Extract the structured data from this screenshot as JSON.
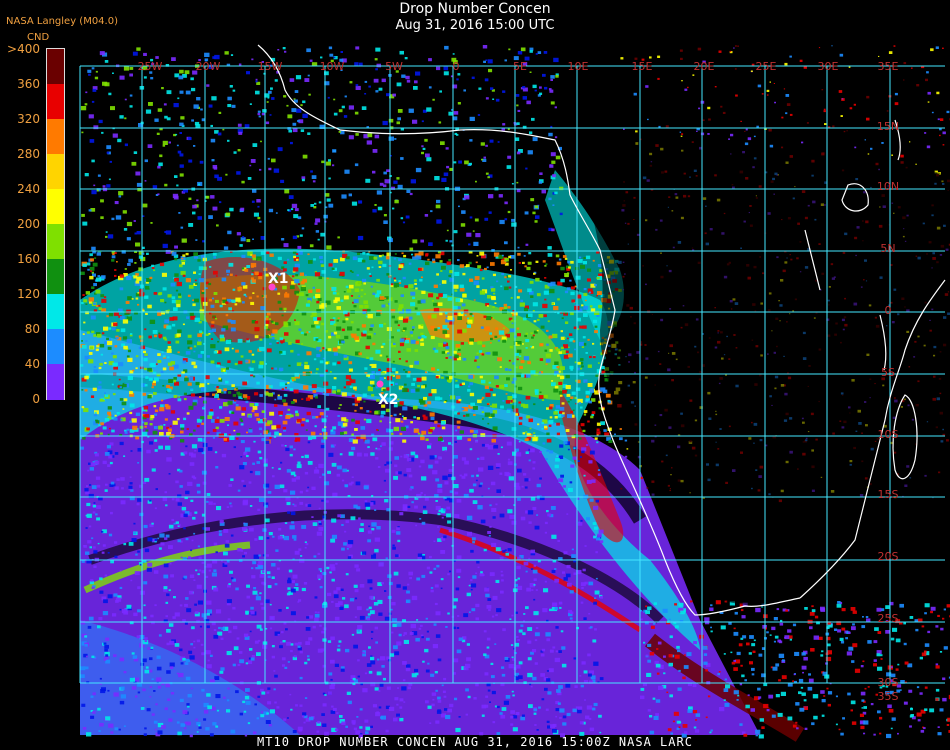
{
  "header": {
    "title": "Drop Number Concen",
    "subtitle": "Aug 31, 2016 15:00 UTC",
    "producer": "NASA Langley (M04.0)",
    "units": "CND"
  },
  "colorbar": {
    "ticks": [
      ">400",
      "360",
      "320",
      "280",
      "240",
      "200",
      "160",
      "120",
      "80",
      "40",
      "0"
    ],
    "colors": [
      "#6a0000",
      "#e80000",
      "#ff7a00",
      "#ffd400",
      "#ffff00",
      "#7fe000",
      "#109010",
      "#00e8e8",
      "#1c8cff",
      "#0016e8",
      "#7a2aff"
    ]
  },
  "map": {
    "background_color": "#000000",
    "grid_color": "#44e8ff",
    "coast_color": "#ffffff",
    "lon_labels": [
      "25W",
      "20W",
      "15W",
      "10W",
      "5W",
      "0",
      "5E",
      "10E",
      "15E",
      "20E",
      "25E",
      "30E",
      "35E"
    ],
    "lat_labels": [
      "15N",
      "10N",
      "5N",
      "0",
      "5S",
      "10S",
      "15S",
      "20S",
      "25S",
      "30S",
      "35S"
    ],
    "markers": [
      {
        "label": "X1",
        "color": "#ff44cc"
      },
      {
        "label": "X2",
        "color": "#ff44cc"
      }
    ]
  },
  "footer": "MT10  DROP NUMBER CONCEN   AUG 31, 2016 15:00Z   NASA LARC"
}
